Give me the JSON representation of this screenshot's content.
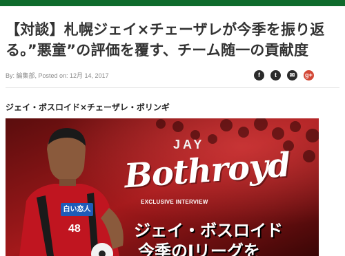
{
  "header": {
    "accent_color": "#0f6b2c"
  },
  "article": {
    "title": "【対談】札幌ジェイ×チェーザレが今季を振り返る。”悪童”の評価を覆す、チーム随一の貢献度",
    "meta": "By: 編集部, Posted on: 12月 14, 2017",
    "subhead": "ジェイ・ボスロイド×チェーザレ・ボリンギ"
  },
  "social": [
    {
      "name": "facebook-icon",
      "glyph": "f",
      "color": "#2b2b2b"
    },
    {
      "name": "twitter-icon",
      "glyph": "t",
      "color": "#2b2b2b"
    },
    {
      "name": "mail-icon",
      "glyph": "✉",
      "color": "#2b2b2b"
    },
    {
      "name": "google-plus-icon",
      "glyph": "g+",
      "color": "#d34836"
    }
  ],
  "hero": {
    "name_small": "JAY",
    "name_large": "Bothroyd",
    "tag": "EXCLUSIVE INTERVIEW",
    "line1": "ジェイ・ボスロイド",
    "line2": "今季のJリーグを",
    "sponsor": "白い恋人",
    "jersey_number": "48"
  }
}
